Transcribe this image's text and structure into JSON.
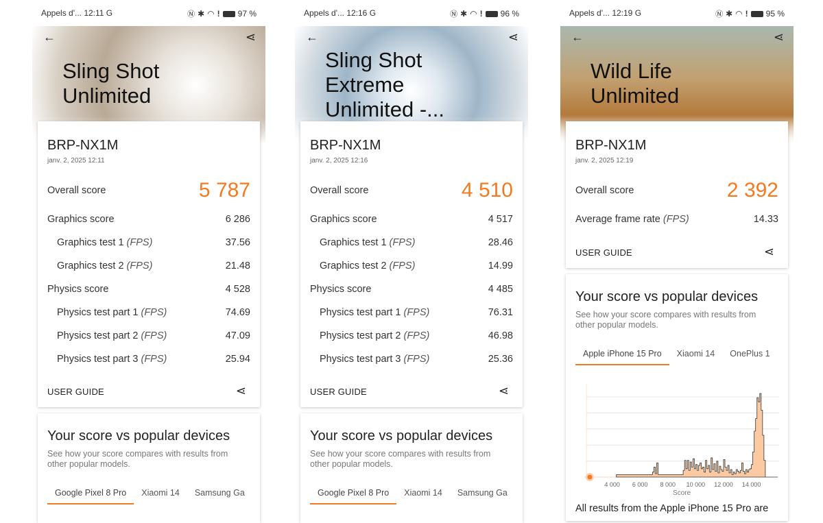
{
  "colors": {
    "accent": "#f47a20",
    "histogram_fill": "#fbcaa2"
  },
  "panels": [
    {
      "status": {
        "left": "Appels d'... 12:11 G",
        "battery": "97 %"
      },
      "title_lines": [
        "Sling Shot",
        "Unlimited"
      ],
      "device": "BRP-NX1M",
      "date": "janv. 2, 2025 12:11",
      "overall_label": "Overall score",
      "overall_value": "5 787",
      "rows": [
        {
          "label": "Graphics score",
          "value": "6 286",
          "sub": false
        },
        {
          "label": "Graphics test 1",
          "unit": "(FPS)",
          "value": "37.56",
          "sub": true
        },
        {
          "label": "Graphics test 2",
          "unit": "(FPS)",
          "value": "21.48",
          "sub": true
        },
        {
          "label": "Physics score",
          "value": "4 528",
          "sub": false
        },
        {
          "label": "Physics test part 1",
          "unit": "(FPS)",
          "value": "74.69",
          "sub": true
        },
        {
          "label": "Physics test part 2",
          "unit": "(FPS)",
          "value": "47.09",
          "sub": true
        },
        {
          "label": "Physics test part 3",
          "unit": "(FPS)",
          "value": "25.94",
          "sub": true
        }
      ],
      "user_guide": "USER GUIDE",
      "compare_title": "Your score vs popular devices",
      "compare_desc": "See how your score compares with results from other popular models.",
      "tabs": [
        "Google Pixel 8 Pro",
        "Xiaomi 14",
        "Samsung Ga"
      ]
    },
    {
      "status": {
        "left": "Appels d'... 12:16 G",
        "battery": "96 %"
      },
      "title_lines": [
        "Sling Shot",
        "Extreme",
        "Unlimited -..."
      ],
      "device": "BRP-NX1M",
      "date": "janv. 2, 2025 12:16",
      "overall_label": "Overall score",
      "overall_value": "4 510",
      "rows": [
        {
          "label": "Graphics score",
          "value": "4 517",
          "sub": false
        },
        {
          "label": "Graphics test 1",
          "unit": "(FPS)",
          "value": "28.46",
          "sub": true
        },
        {
          "label": "Graphics test 2",
          "unit": "(FPS)",
          "value": "14.99",
          "sub": true
        },
        {
          "label": "Physics score",
          "value": "4 485",
          "sub": false
        },
        {
          "label": "Physics test part 1",
          "unit": "(FPS)",
          "value": "76.31",
          "sub": true
        },
        {
          "label": "Physics test part 2",
          "unit": "(FPS)",
          "value": "46.98",
          "sub": true
        },
        {
          "label": "Physics test part 3",
          "unit": "(FPS)",
          "value": "25.36",
          "sub": true
        }
      ],
      "user_guide": "USER GUIDE",
      "compare_title": "Your score vs popular devices",
      "compare_desc": "See how your score compares with results from other popular models.",
      "tabs": [
        "Google Pixel 8 Pro",
        "Xiaomi 14",
        "Samsung Ga"
      ]
    },
    {
      "status": {
        "left": "Appels d'... 12:19 G",
        "battery": "95 %"
      },
      "title_lines": [
        "Wild Life",
        "Unlimited"
      ],
      "device": "BRP-NX1M",
      "date": "janv. 2, 2025 12:19",
      "overall_label": "Overall score",
      "overall_value": "2 392",
      "rows": [
        {
          "label": "Average frame rate",
          "unit": "(FPS)",
          "value": "14.33",
          "sub": false
        }
      ],
      "user_guide": "USER GUIDE",
      "compare_title": "Your score vs popular devices",
      "compare_desc": "See how your score compares with results from other popular models.",
      "tabs": [
        "Apple iPhone 15 Pro",
        "Xiaomi 14",
        "OnePlus 1"
      ],
      "footer_text": "All results from the Apple iPhone 15 Pro are"
    }
  ],
  "chart_data": {
    "type": "area",
    "xlabel": "Score",
    "xticks": [
      "4 000",
      "6 000",
      "8 000",
      "10 000",
      "12 000",
      "14 000"
    ],
    "xlim": [
      2000,
      16500
    ],
    "your_score": 2392,
    "grid": true,
    "x": [
      4300,
      6800,
      6900,
      7000,
      7100,
      7200,
      7300,
      9000,
      9100,
      9200,
      9300,
      9400,
      9500,
      9600,
      9700,
      9800,
      9900,
      10000,
      10100,
      10200,
      10300,
      10400,
      10500,
      10600,
      10700,
      10800,
      10900,
      11000,
      11100,
      11200,
      11300,
      11400,
      11500,
      11600,
      11700,
      11800,
      11900,
      12000,
      12100,
      12200,
      12300,
      12400,
      12500,
      12600,
      12700,
      12800,
      12900,
      13000,
      13100,
      13200,
      13300,
      13400,
      13500,
      13600,
      13700,
      13800,
      13900,
      14000,
      14100,
      14200,
      14300,
      14400,
      14500,
      14600,
      14700,
      14800,
      14900,
      15000,
      15100,
      15200,
      15300,
      15400,
      15500,
      15600,
      15700,
      15800
    ],
    "y": [
      0.03,
      0.03,
      0.06,
      0.12,
      0.04,
      0.17,
      0.03,
      0.03,
      0.08,
      0.2,
      0.1,
      0.2,
      0.08,
      0.18,
      0.12,
      0.22,
      0.1,
      0.15,
      0.08,
      0.14,
      0.17,
      0.1,
      0.12,
      0.06,
      0.2,
      0.1,
      0.14,
      0.06,
      0.23,
      0.09,
      0.16,
      0.07,
      0.19,
      0.05,
      0.13,
      0.09,
      0.07,
      0.21,
      0.12,
      0.08,
      0.14,
      0.05,
      0.09,
      0.03,
      0.06,
      0.04,
      0.09,
      0.07,
      0.05,
      0.08,
      0.17,
      0.07,
      0.04,
      0.09,
      0.06,
      0.09,
      0.1,
      0.15,
      0.3,
      0.55,
      0.7,
      0.95,
      0.9,
      1.0,
      0.8,
      0.5,
      0.2,
      0.0,
      0.0,
      0.0,
      0.0,
      0.0,
      0.0,
      0.0,
      0.0,
      0.0
    ]
  }
}
